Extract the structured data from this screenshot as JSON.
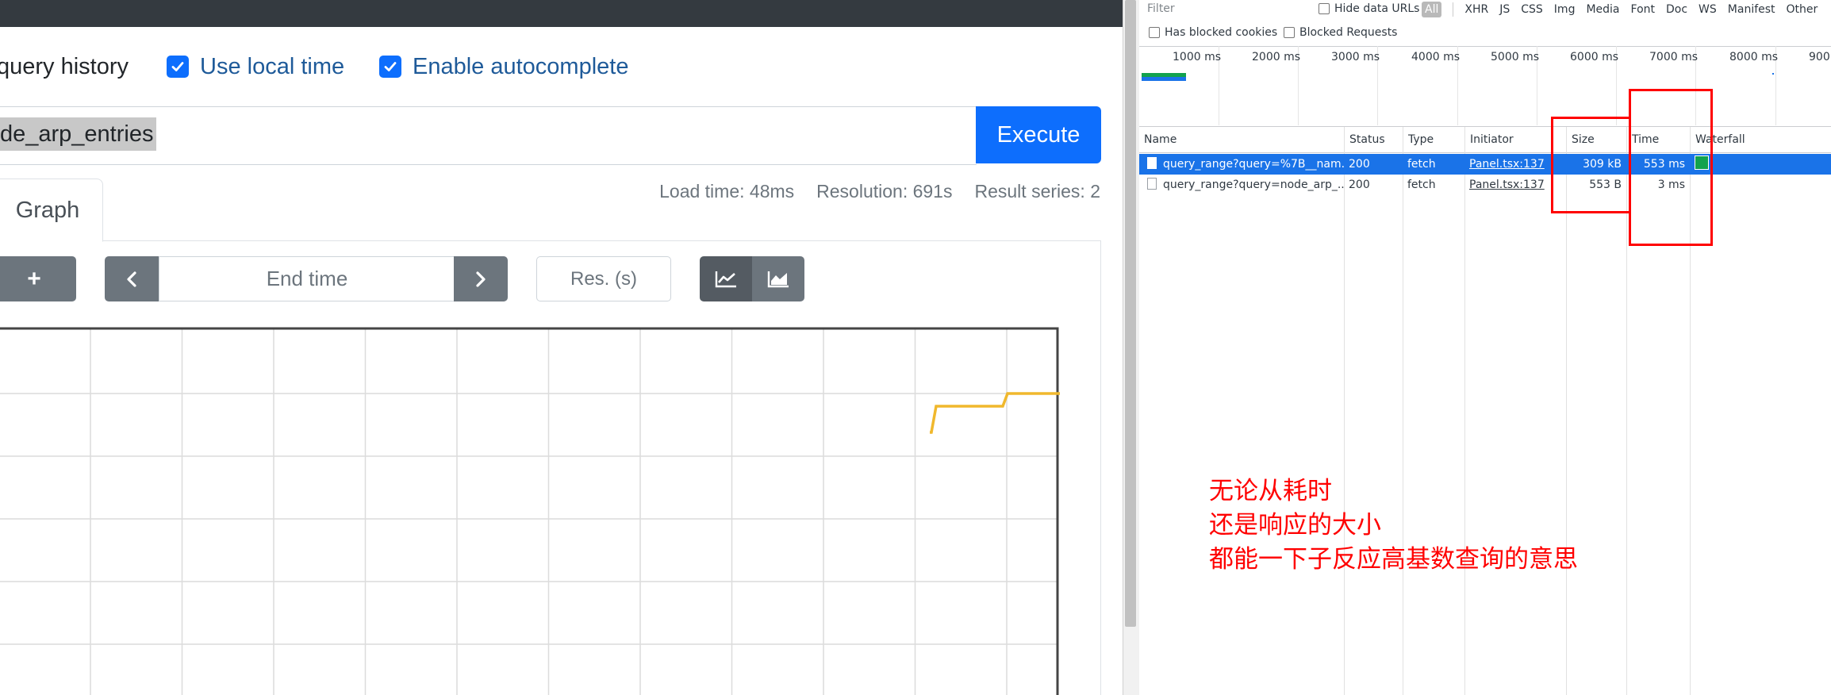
{
  "prometheus": {
    "checkboxes": [
      {
        "label": "query history",
        "checked": false
      },
      {
        "label": "Use local time",
        "checked": true
      },
      {
        "label": "Enable autocomplete",
        "checked": true
      }
    ],
    "query_text": "de_arp_entries",
    "execute_label": "Execute",
    "tab_label": "Graph",
    "stats": {
      "load_time": "Load time: 48ms",
      "resolution": "Resolution: 691s",
      "result_series": "Result series: 2"
    },
    "controls": {
      "plus_label": "+",
      "end_time_placeholder": "End time",
      "res_placeholder": "Res. (s)"
    },
    "line_color": "#f0b82d"
  },
  "devtools": {
    "filter_placeholder": "Filter",
    "hide_data_urls": "Hide data URLs",
    "type_filters": [
      "All",
      "XHR",
      "JS",
      "CSS",
      "Img",
      "Media",
      "Font",
      "Doc",
      "WS",
      "Manifest",
      "Other"
    ],
    "has_blocked_cookies": "Has blocked cookies",
    "blocked_requests": "Blocked Requests",
    "overview_ticks": [
      "1000 ms",
      "2000 ms",
      "3000 ms",
      "4000 ms",
      "5000 ms",
      "6000 ms",
      "7000 ms",
      "8000 ms",
      "900"
    ],
    "columns": [
      "Name",
      "Status",
      "Type",
      "Initiator",
      "Size",
      "Time",
      "Waterfall"
    ],
    "rows": [
      {
        "name": "query_range?query=%7B__nam...",
        "status": "200",
        "type": "fetch",
        "initiator": "Panel.tsx:137",
        "size": "309 kB",
        "time": "553 ms",
        "selected": true
      },
      {
        "name": "query_range?query=node_arp_...",
        "status": "200",
        "type": "fetch",
        "initiator": "Panel.tsx:137",
        "size": "553 B",
        "time": "3 ms",
        "selected": false
      }
    ],
    "selected_color": "#1a73e8",
    "waterfall_color": "#12a24d"
  },
  "annotation": {
    "lines": [
      "无论从耗时",
      "还是响应的大小",
      "都能一下子反应高基数查询的意思"
    ],
    "color": "#ff0000"
  }
}
